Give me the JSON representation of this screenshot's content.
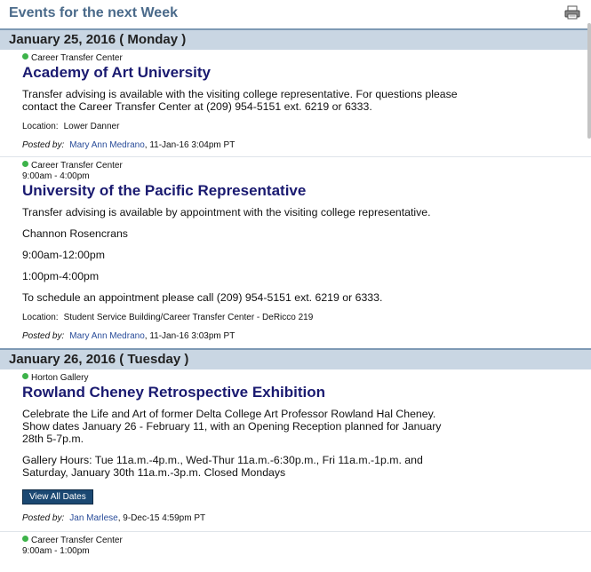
{
  "header": {
    "title": "Events for the next Week"
  },
  "days": [
    {
      "label": "January 25, 2016 ( Monday )",
      "events": [
        {
          "calendar": "Career Transfer Center",
          "title": "Academy of Art University",
          "description": [
            "Transfer advising is available with the visiting college representative. For questions please contact the Career Transfer Center at (209) 954-5151 ext. 6219 or 6333."
          ],
          "location_label": "Location:",
          "location": "Lower Danner",
          "posted_label": "Posted by:",
          "posted_by": "Mary Ann Medrano",
          "posted_date": ", 11-Jan-16 3:04pm PT"
        },
        {
          "calendar": "Career Transfer Center",
          "time": "9:00am - 4:00pm",
          "title": "University of the Pacific Representative",
          "description": [
            "Transfer advising is available by appointment with the visiting college representative.",
            "Channon Rosencrans",
            "9:00am-12:00pm",
            "1:00pm-4:00pm",
            "To schedule an appointment please call (209) 954-5151 ext. 6219 or 6333."
          ],
          "location_label": "Location:",
          "location": "Student Service Building/Career Transfer Center - DeRicco 219",
          "posted_label": "Posted by:",
          "posted_by": "Mary Ann Medrano",
          "posted_date": ", 11-Jan-16 3:03pm PT"
        }
      ]
    },
    {
      "label": "January 26, 2016 ( Tuesday )",
      "events": [
        {
          "calendar": "Horton Gallery",
          "title": "Rowland Cheney Retrospective Exhibition",
          "description": [
            "Celebrate the Life and Art of former Delta College Art Professor Rowland Hal Cheney. Show dates January 26 - February 11, with an Opening Reception planned for January 28th 5-7p.m.",
            "Gallery Hours: Tue 11a.m.-4p.m., Wed-Thur 11a.m.-6:30p.m., Fri 11a.m.-1p.m. and Saturday, January 30th 11a.m.-3p.m. Closed Mondays"
          ],
          "button": "View All Dates",
          "posted_label": "Posted by:",
          "posted_by": "Jan Marlese",
          "posted_date": ", 9-Dec-15 4:59pm PT"
        },
        {
          "calendar": "Career Transfer Center",
          "time": "9:00am - 1:00pm"
        }
      ]
    }
  ]
}
